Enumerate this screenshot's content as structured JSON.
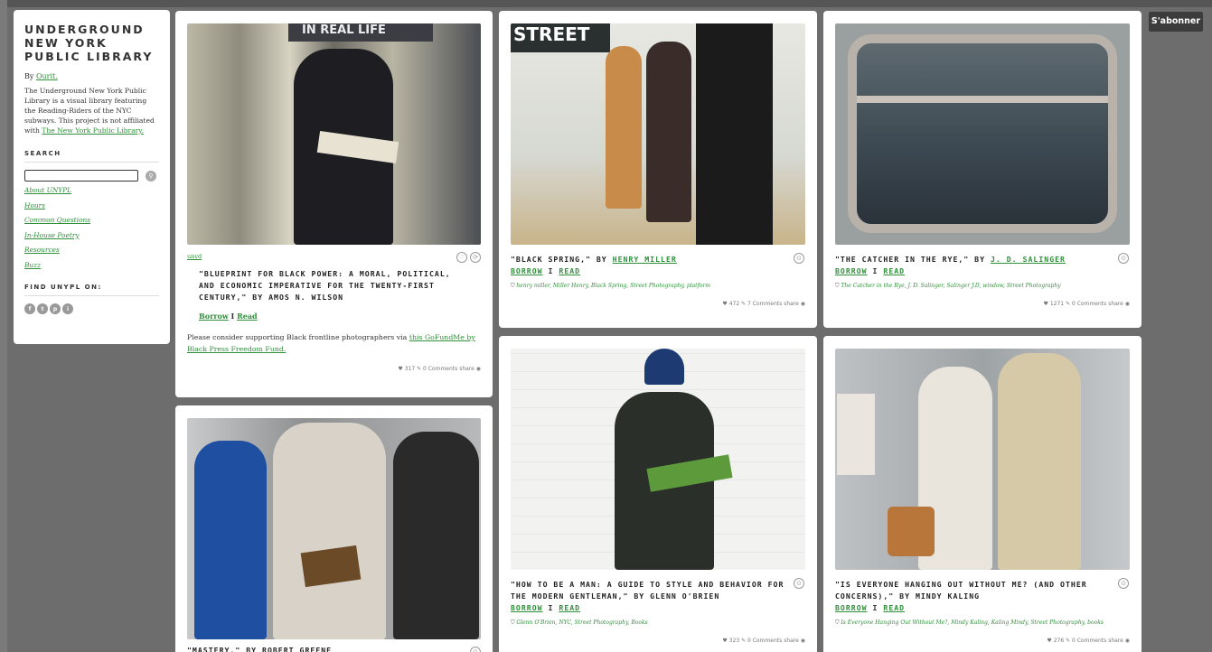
{
  "blog": {
    "title": "UNDERGROUND NEW YORK PUBLIC LIBRARY",
    "by_label": "By",
    "author": "Ourit.",
    "description": "The Underground New York Public Library is a visual library featuring the Reading-Riders of the NYC subways. This project is not affiliated with",
    "affiliation_link": "The New York Public Library.",
    "search_heading": "SEARCH",
    "links": [
      "About UNYPL",
      "Hours",
      "Common Questions",
      "In-House Poetry",
      "Resources",
      "Buzz"
    ],
    "find_heading": "FIND UNYPL ON:",
    "social": [
      "f",
      "t",
      "p",
      "i"
    ]
  },
  "topbar": {
    "icons": [
      "home-icon",
      "plus-icon",
      "user-icon"
    ],
    "subscribe": "S'abonner"
  },
  "posts": [
    {
      "category": "unyd",
      "title": "\"Blueprint for Black Power: A Moral, Political, and Economic Imperative for the Twenty-First Century,\" by Amos N. Wilson",
      "borrow": "Borrow",
      "sep": "I",
      "read": "Read",
      "note_text": "Please consider supporting Black frontline photographers via",
      "note_link": "this GoFundMe by Black Press Freedom Fund.",
      "likes": "317",
      "comments": "0 Comments",
      "share": "share"
    },
    {
      "title_prefix": "\"Black Spring,\" by",
      "author": "Henry Miller",
      "borrow": "BORROW",
      "sep": "I",
      "read": "READ",
      "tags": "henry miller, Miller Henry, Black Spring, Street Photography, platform",
      "likes": "472",
      "comments": "7 Comments",
      "share": "share"
    },
    {
      "title_prefix": "\"The Catcher in the Rye,\" by",
      "author": "J. D. Salinger",
      "borrow": "BORROW",
      "sep": "I",
      "read": "READ",
      "tags": "The Catcher in the Rye, J. D. Salinger, Salinger J.D, window, Street Photography",
      "likes": "1271",
      "comments": "0 Comments",
      "share": "share"
    },
    {
      "title": "\"Mastery,\" by Robert Greene"
    },
    {
      "title": "\"How to Be a Man: A Guide to Style and Behavior for the Modern Gentleman,\" by Glenn O'Brien",
      "borrow": "BORROW",
      "sep": "I",
      "read": "READ",
      "tags": "Glenn O'Brien, NYC, Street Photography, Books",
      "likes": "323",
      "comments": "0 Comments",
      "share": "share"
    },
    {
      "title": "\"Is Everyone Hanging Out Without Me? (And Other Concerns),\" by Mindy Kaling",
      "borrow": "BORROW",
      "sep": "I",
      "read": "READ",
      "tags": "Is Everyone Hanging Out Without Me?, Mindy Kaling, Kaling Mindy, Street Photography, books",
      "likes": "276",
      "comments": "0 Comments",
      "share": "share"
    }
  ]
}
